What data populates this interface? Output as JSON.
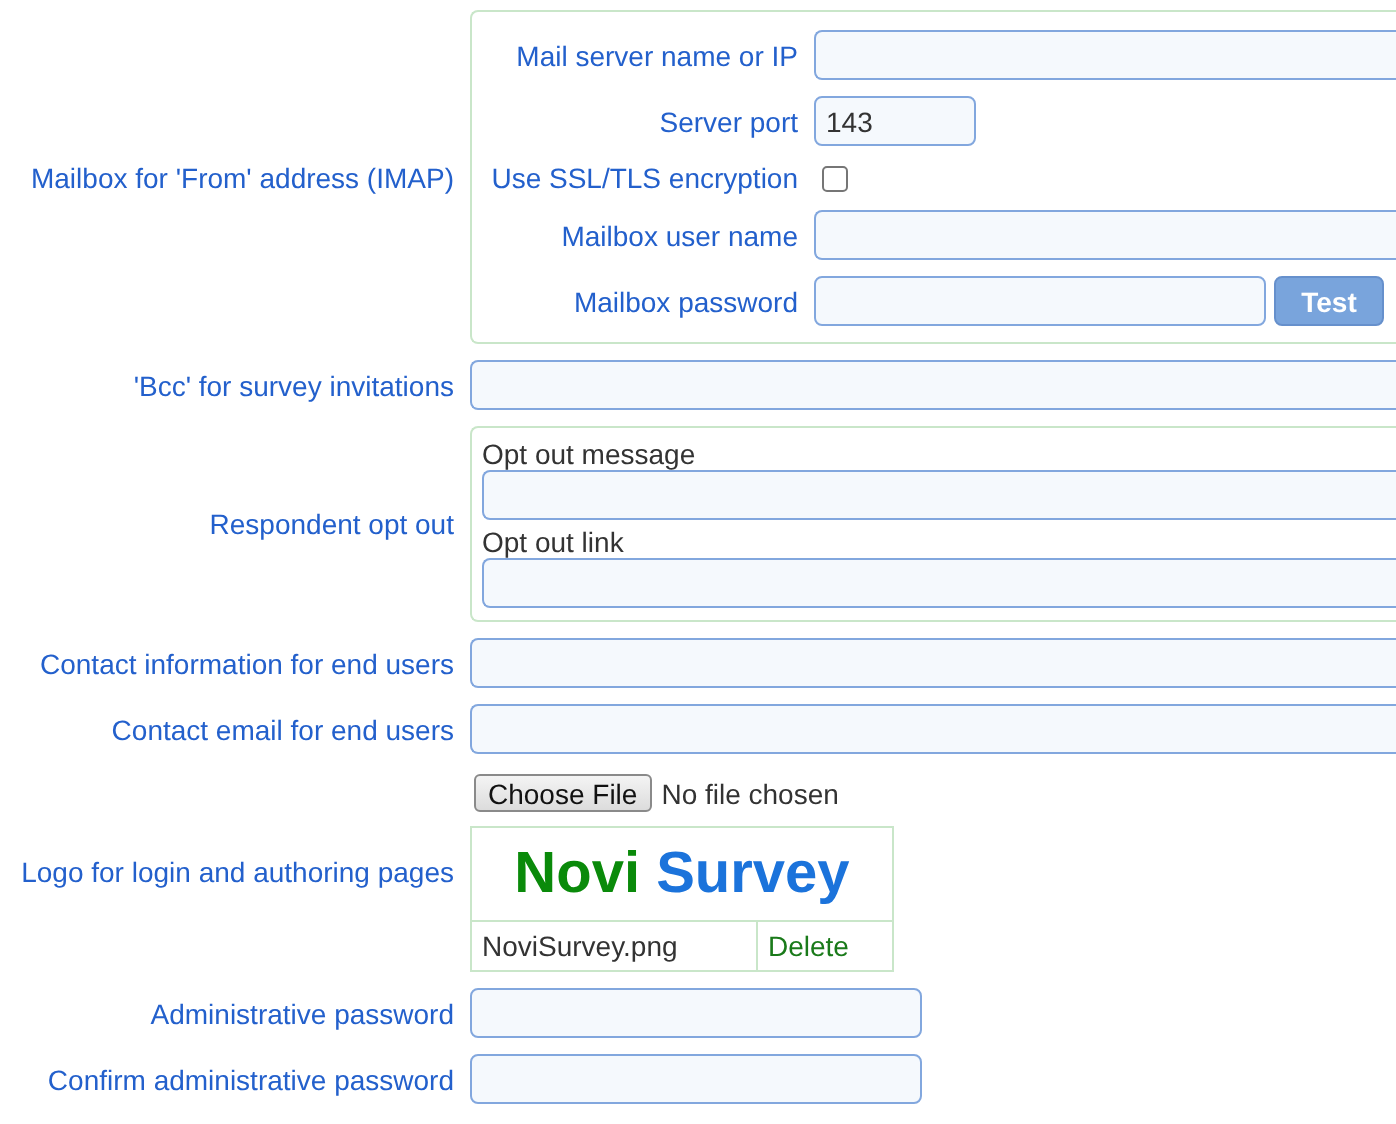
{
  "settings": [
    {
      "kind": "group",
      "label": "Mailbox for 'From' address (IMAP)",
      "fields": [
        {
          "kind": "text",
          "label": "Mail server name or IP"
        },
        {
          "kind": "port",
          "label": "Server port",
          "value": "143"
        },
        {
          "kind": "checkbox",
          "label": "Use SSL/TLS encryption",
          "checked": false
        },
        {
          "kind": "text",
          "label": "Mailbox user name"
        },
        {
          "kind": "test",
          "label": "Mailbox password",
          "button": "Test"
        }
      ]
    },
    {
      "kind": "text",
      "label": "'Bcc' for survey invitations"
    },
    {
      "kind": "stacked",
      "label": "Respondent opt out",
      "fields": [
        {
          "label": "Opt out message"
        },
        {
          "label": "Opt out link"
        }
      ]
    },
    {
      "kind": "text",
      "label": "Contact information for end users"
    },
    {
      "kind": "text",
      "label": "Contact email for end users"
    },
    {
      "kind": "logo",
      "label": "Logo for login and authoring pages",
      "file_button": "Choose File",
      "file_status": "No file chosen",
      "logo_word_1": "Novi",
      "logo_word_2": "Survey",
      "file_name": "NoviSurvey.png",
      "delete": "Delete"
    },
    {
      "kind": "short",
      "label": "Administrative password"
    },
    {
      "kind": "short",
      "label": "Confirm administrative password"
    }
  ]
}
